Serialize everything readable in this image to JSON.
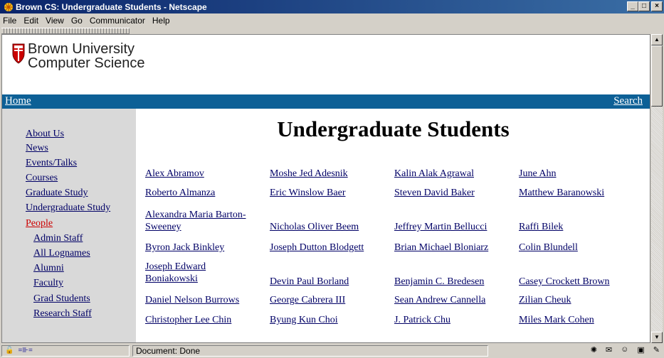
{
  "window": {
    "title": "Brown CS: Undergraduate Students - Netscape"
  },
  "menu": [
    "File",
    "Edit",
    "View",
    "Go",
    "Communicator",
    "Help"
  ],
  "logo": {
    "line1": "Brown University",
    "line2": "Computer Science"
  },
  "topnav": {
    "home": "Home",
    "search": "Search"
  },
  "sidebar": [
    "About Us",
    "News",
    "Events/Talks",
    "Courses",
    "Graduate Study",
    "Undergraduate Study",
    "People",
    "Admin Staff",
    "All Lognames",
    "Alumni",
    "Faculty",
    "Grad Students",
    "Research Staff"
  ],
  "page_title": "Undergraduate Students",
  "students": [
    [
      "Alex Abramov",
      "Moshe Jed Adesnik",
      "Kalin Alak Agrawal",
      "June Ahn"
    ],
    [
      "Roberto Almanza",
      "Eric Winslow Baer",
      "Steven David Baker",
      "Matthew Baranowski"
    ],
    [
      "Alexandra Maria Barton-Sweeney",
      "Nicholas Oliver Beem",
      "Jeffrey Martin Bellucci",
      "Raffi Bilek"
    ],
    [
      "Byron Jack Binkley",
      "Joseph Dutton Blodgett",
      "Brian Michael Bloniarz",
      "Colin Blundell"
    ],
    [
      "Joseph Edward Boniakowski",
      "Devin Paul Borland",
      "Benjamin C. Bredesen",
      "Casey Crockett Brown"
    ],
    [
      "Daniel Nelson Burrows",
      "George Cabrera III",
      "Sean Andrew Cannella",
      "Zilian Cheuk"
    ],
    [
      "Christopher Lee Chin",
      "Byung Kun Choi",
      "J. Patrick Chu",
      "Miles Mark Cohen"
    ]
  ],
  "status": {
    "text": "Document: Done"
  }
}
